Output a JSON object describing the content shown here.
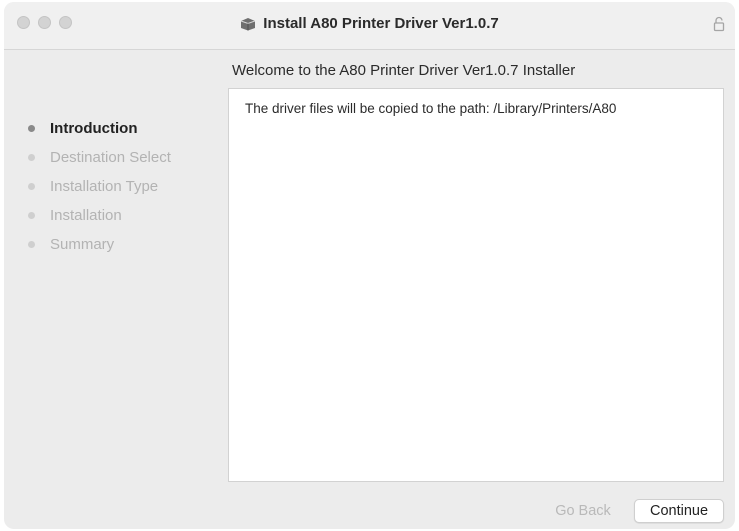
{
  "window": {
    "title": "Install A80 Printer Driver Ver1.0.7"
  },
  "header": {
    "welcome": "Welcome to the A80 Printer Driver Ver1.0.7 Installer"
  },
  "sidebar": {
    "steps": [
      {
        "label": "Introduction",
        "active": true
      },
      {
        "label": "Destination Select",
        "active": false
      },
      {
        "label": "Installation Type",
        "active": false
      },
      {
        "label": "Installation",
        "active": false
      },
      {
        "label": "Summary",
        "active": false
      }
    ]
  },
  "content": {
    "text": "The driver files will be copied to the path: /Library/Printers/A80"
  },
  "buttons": {
    "back_label": "Go Back",
    "continue_label": "Continue"
  },
  "icons": {
    "window_icon": "package-icon",
    "lock": "lock-icon"
  }
}
